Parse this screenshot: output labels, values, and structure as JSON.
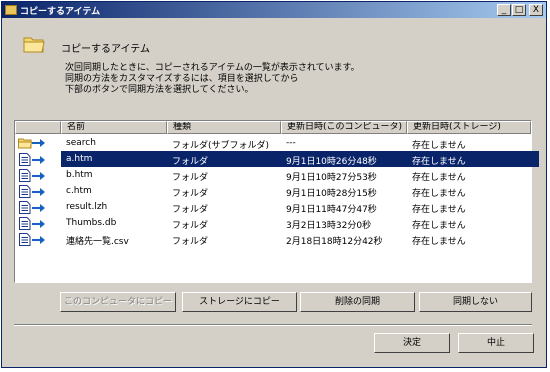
{
  "window": {
    "title": "コピーするアイテム",
    "min": "_",
    "max": "□",
    "close": "X"
  },
  "header": {
    "title": "コピーするアイテム"
  },
  "description": [
    "次回同期したときに、コピーされるアイテムの一覧が表示されています。",
    "同期の方法をカスタマイズするには、項目を選択してから",
    "下部のボタンで同期方法を選択してください。"
  ],
  "columns": [
    "名前",
    "種類",
    "更新日時(このコンピュータ)",
    "更新日時(ストレージ)"
  ],
  "rows": [
    {
      "icon": "folder-arrow-icon",
      "name": "search",
      "type": "フォルダ(サブフォルダ)",
      "local": "---",
      "storage": "存在しません"
    },
    {
      "icon": "document-arrow-icon",
      "name": "a.htm",
      "type": "フォルダ",
      "local": "9月1日10時26分48秒",
      "storage": "存在しません",
      "selected": true
    },
    {
      "icon": "document-arrow-icon",
      "name": "b.htm",
      "type": "フォルダ",
      "local": "9月1日10時27分53秒",
      "storage": "存在しません"
    },
    {
      "icon": "document-arrow-icon",
      "name": "c.htm",
      "type": "フォルダ",
      "local": "9月1日10時28分15秒",
      "storage": "存在しません"
    },
    {
      "icon": "document-arrow-icon",
      "name": "result.lzh",
      "type": "フォルダ",
      "local": "9月1日11時47分47秒",
      "storage": "存在しません"
    },
    {
      "icon": "document-arrow-icon",
      "name": "Thumbs.db",
      "type": "フォルダ",
      "local": "3月2日13時32分0秒",
      "storage": "存在しません"
    },
    {
      "icon": "document-arrow-icon",
      "name": "連絡先一覧.csv",
      "type": "フォルダ",
      "local": "2月18日18時12分42秒",
      "storage": "存在しません"
    }
  ],
  "actions": {
    "copy_to_computer": "このコンピュータにコピー",
    "copy_to_storage": "ストレージにコピー",
    "sync_delete": "削除の同期",
    "no_sync": "同期しない"
  },
  "footer": {
    "ok": "決定",
    "cancel": "中止"
  },
  "colors": {
    "titlebar_start": "#0a246a",
    "titlebar_end": "#a6caf0",
    "selection": "#0a246a",
    "face": "#d4d0c8"
  }
}
